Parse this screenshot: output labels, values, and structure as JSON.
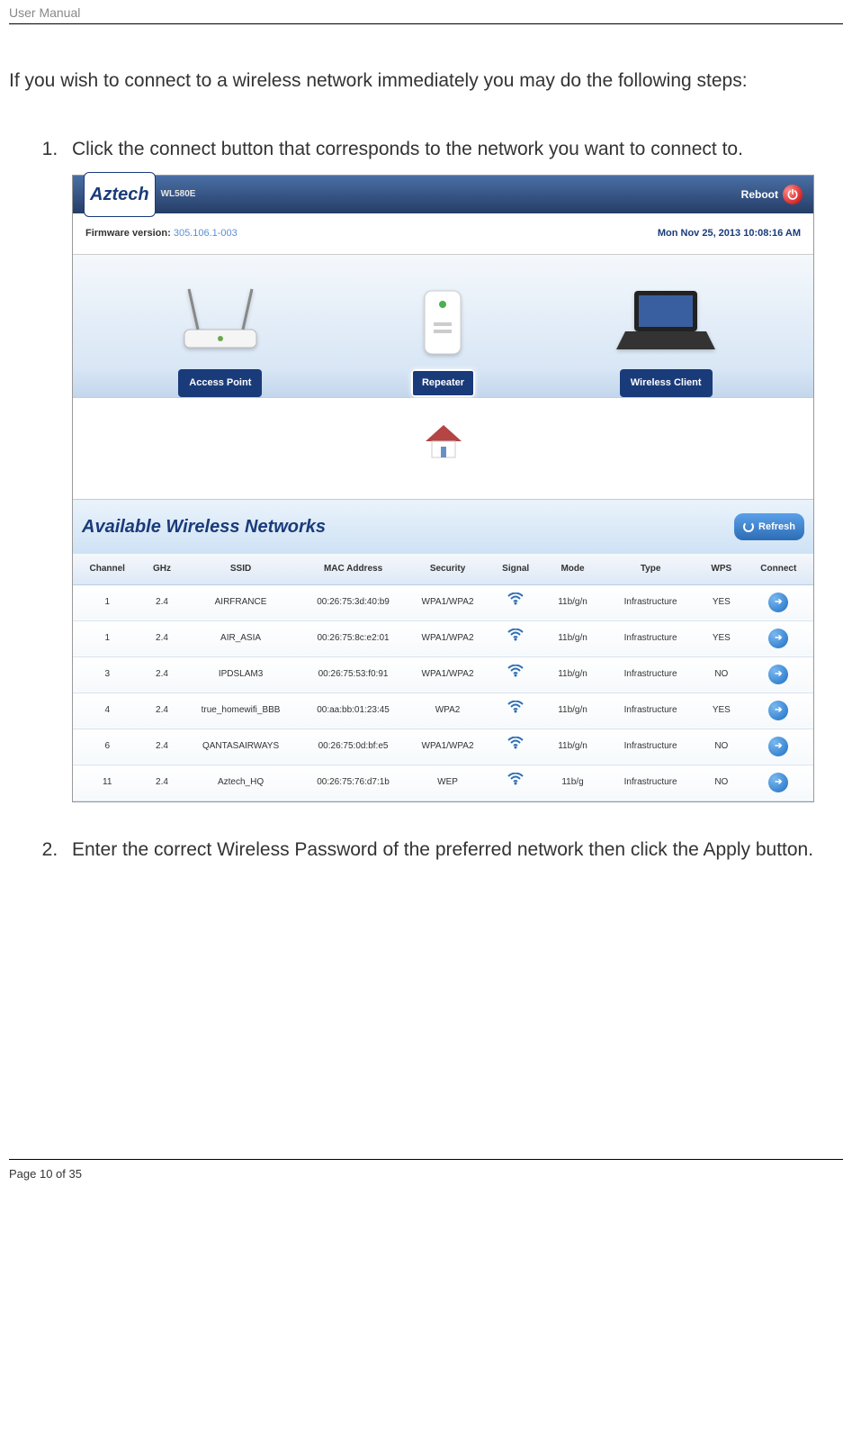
{
  "header": "User Manual",
  "intro": "If you wish to connect to a wireless network immediately you may do the following steps:",
  "steps": [
    "Click the connect button that corresponds to the network you want to connect to.",
    "Enter the correct Wireless Password of the preferred network then click the Apply button."
  ],
  "footer": "Page 10 of 35",
  "ui": {
    "brand": "Aztech",
    "model": "WL580E",
    "reboot": "Reboot",
    "firmware_label": "Firmware version:",
    "firmware_value": "305.106.1-003",
    "datetime": "Mon Nov 25, 2013 10:08:16 AM",
    "modes": {
      "ap": "Access Point",
      "repeater": "Repeater",
      "client": "Wireless Client"
    },
    "section_title": "Available Wireless Networks",
    "refresh": "Refresh",
    "columns": {
      "channel": "Channel",
      "ghz": "GHz",
      "ssid": "SSID",
      "mac": "MAC Address",
      "security": "Security",
      "signal": "Signal",
      "mode": "Mode",
      "type": "Type",
      "wps": "WPS",
      "connect": "Connect"
    },
    "rows": [
      {
        "ch": "1",
        "ghz": "2.4",
        "ssid": "AIRFRANCE",
        "mac": "00:26:75:3d:40:b9",
        "sec": "WPA1/WPA2",
        "mode": "11b/g/n",
        "type": "Infrastructure",
        "wps": "YES"
      },
      {
        "ch": "1",
        "ghz": "2.4",
        "ssid": "AIR_ASIA",
        "mac": "00:26:75:8c:e2:01",
        "sec": "WPA1/WPA2",
        "mode": "11b/g/n",
        "type": "Infrastructure",
        "wps": "YES"
      },
      {
        "ch": "3",
        "ghz": "2.4",
        "ssid": "IPDSLAM3",
        "mac": "00:26:75:53:f0:91",
        "sec": "WPA1/WPA2",
        "mode": "11b/g/n",
        "type": "Infrastructure",
        "wps": "NO"
      },
      {
        "ch": "4",
        "ghz": "2.4",
        "ssid": "true_homewifi_BBB",
        "mac": "00:aa:bb:01:23:45",
        "sec": "WPA2",
        "mode": "11b/g/n",
        "type": "Infrastructure",
        "wps": "YES"
      },
      {
        "ch": "6",
        "ghz": "2.4",
        "ssid": "QANTASAIRWAYS",
        "mac": "00:26:75:0d:bf:e5",
        "sec": "WPA1/WPA2",
        "mode": "11b/g/n",
        "type": "Infrastructure",
        "wps": "NO"
      },
      {
        "ch": "11",
        "ghz": "2.4",
        "ssid": "Aztech_HQ",
        "mac": "00:26:75:76:d7:1b",
        "sec": "WEP",
        "mode": "11b/g",
        "type": "Infrastructure",
        "wps": "NO"
      }
    ]
  }
}
